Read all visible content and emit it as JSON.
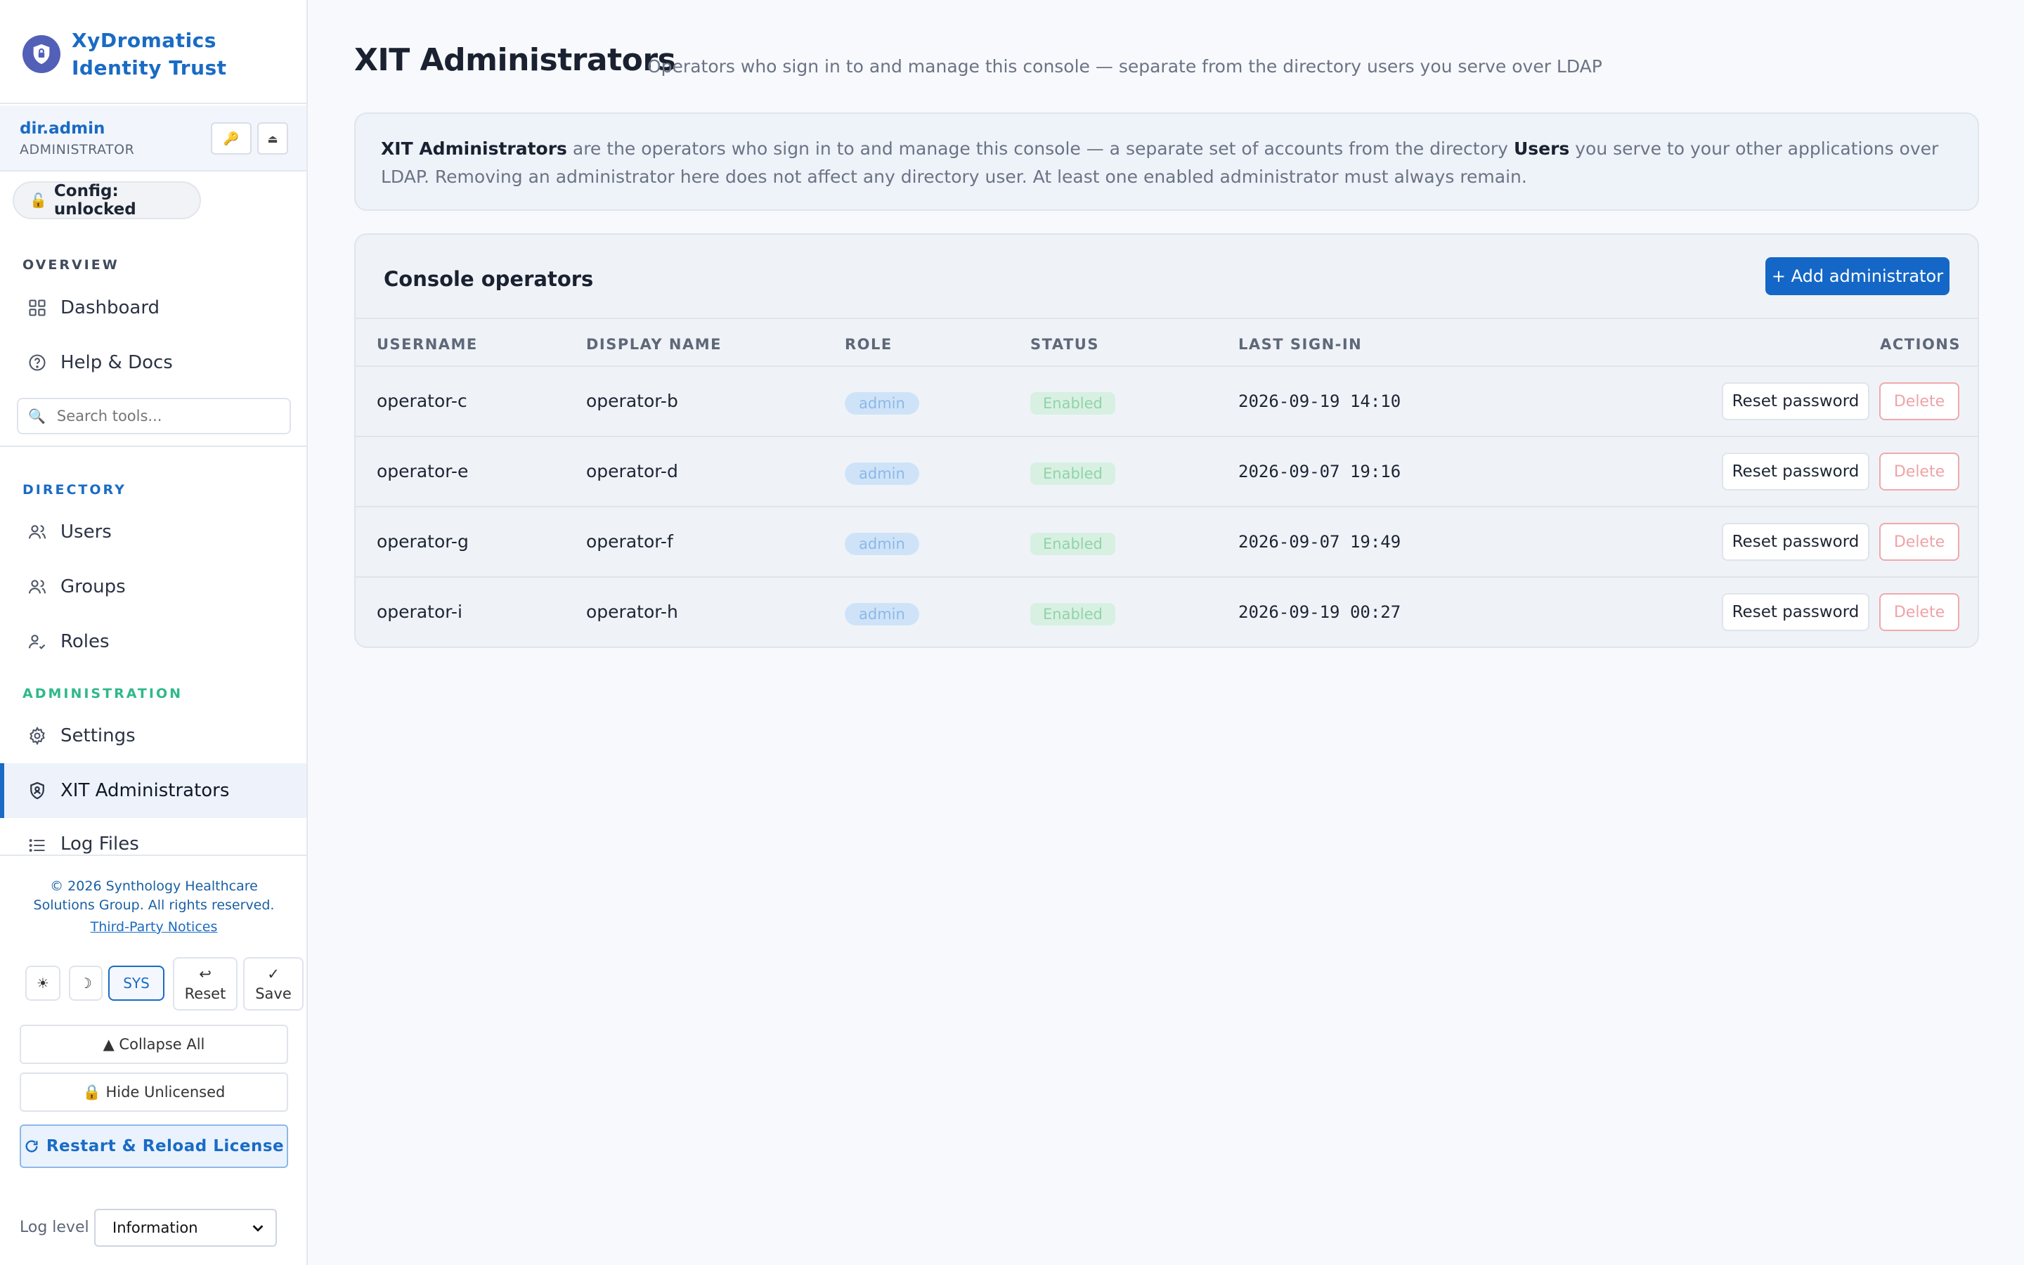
{
  "brand": {
    "title": "XyDromatics Identity Trust",
    "logo_icon": "shield-lock-icon",
    "accent": "#1a6bc4"
  },
  "user": {
    "name": "dir.admin",
    "role": "ADMINISTRATOR",
    "key_icon": "key-icon",
    "eject_icon": "eject-icon"
  },
  "config": {
    "label": "Config: unlocked",
    "icon": "unlocked-icon"
  },
  "nav": {
    "overview_label": "OVERVIEW",
    "overview_items": [
      {
        "label": "Dashboard",
        "icon": "grid-icon"
      },
      {
        "label": "Help & Docs",
        "icon": "help-icon"
      }
    ],
    "search_placeholder": "Search tools...",
    "directory_label": "DIRECTORY",
    "directory_items": [
      {
        "label": "Users",
        "icon": "users-icon"
      },
      {
        "label": "Groups",
        "icon": "groups-icon"
      },
      {
        "label": "Roles",
        "icon": "roles-icon"
      }
    ],
    "administration_label": "ADMINISTRATION",
    "administration_items": [
      {
        "label": "Settings",
        "icon": "gear-icon"
      },
      {
        "label": "XIT Administrators",
        "icon": "shield-icon",
        "active": true
      },
      {
        "label": "Log Files",
        "icon": "list-icon"
      }
    ],
    "section_colors": {
      "overview": "#3f4a5c",
      "directory": "#1a6bc4",
      "administration": "#2fb88a"
    }
  },
  "footer": {
    "copyright": "© 2026 Synthology Healthcare Solutions Group. All rights reserved.",
    "notices_link": "Third-Party Notices",
    "theme": {
      "light_icon": "☀",
      "dark_icon": "☽",
      "system_label": "SYS",
      "selected": "SYS"
    },
    "reset_icon": "↩",
    "reset_label": "Reset",
    "save_icon": "✓",
    "save_label": "Save",
    "collapse_label": "▲ Collapse All",
    "hide_unlicensed_label": "🔒 Hide Unlicensed",
    "restart_label": "Restart & Reload License",
    "log_level_label": "Log level",
    "log_level_value": "Information"
  },
  "page": {
    "title": "XIT Administrators",
    "subtitle": "Operators who sign in to and manage this console — separate from the directory users you serve over LDAP",
    "info": {
      "strong1": "XIT Administrators",
      "text1": " are the operators who sign in to and manage this console — a separate set of accounts from the directory ",
      "strong2": "Users",
      "text2": " you serve to your other applications over LDAP. Removing an administrator here does not affect any directory user. At least one enabled administrator must always remain."
    }
  },
  "operators": {
    "title": "Console operators",
    "add_label": "+ Add administrator",
    "columns": [
      "USERNAME",
      "DISPLAY NAME",
      "ROLE",
      "STATUS",
      "LAST SIGN-IN",
      "ACTIONS"
    ],
    "reset_label": "Reset password",
    "delete_label": "Delete",
    "rows": [
      {
        "username": "operator-c",
        "display_name": "operator-b",
        "role": "admin",
        "status": "Enabled",
        "last_sign_in": "2026-09-19 14:10"
      },
      {
        "username": "operator-e",
        "display_name": "operator-d",
        "role": "admin",
        "status": "Enabled",
        "last_sign_in": "2026-09-07 19:16"
      },
      {
        "username": "operator-g",
        "display_name": "operator-f",
        "role": "admin",
        "status": "Enabled",
        "last_sign_in": "2026-09-07 19:49"
      },
      {
        "username": "operator-i",
        "display_name": "operator-h",
        "role": "admin",
        "status": "Enabled",
        "last_sign_in": "2026-09-19 00:27"
      }
    ]
  }
}
